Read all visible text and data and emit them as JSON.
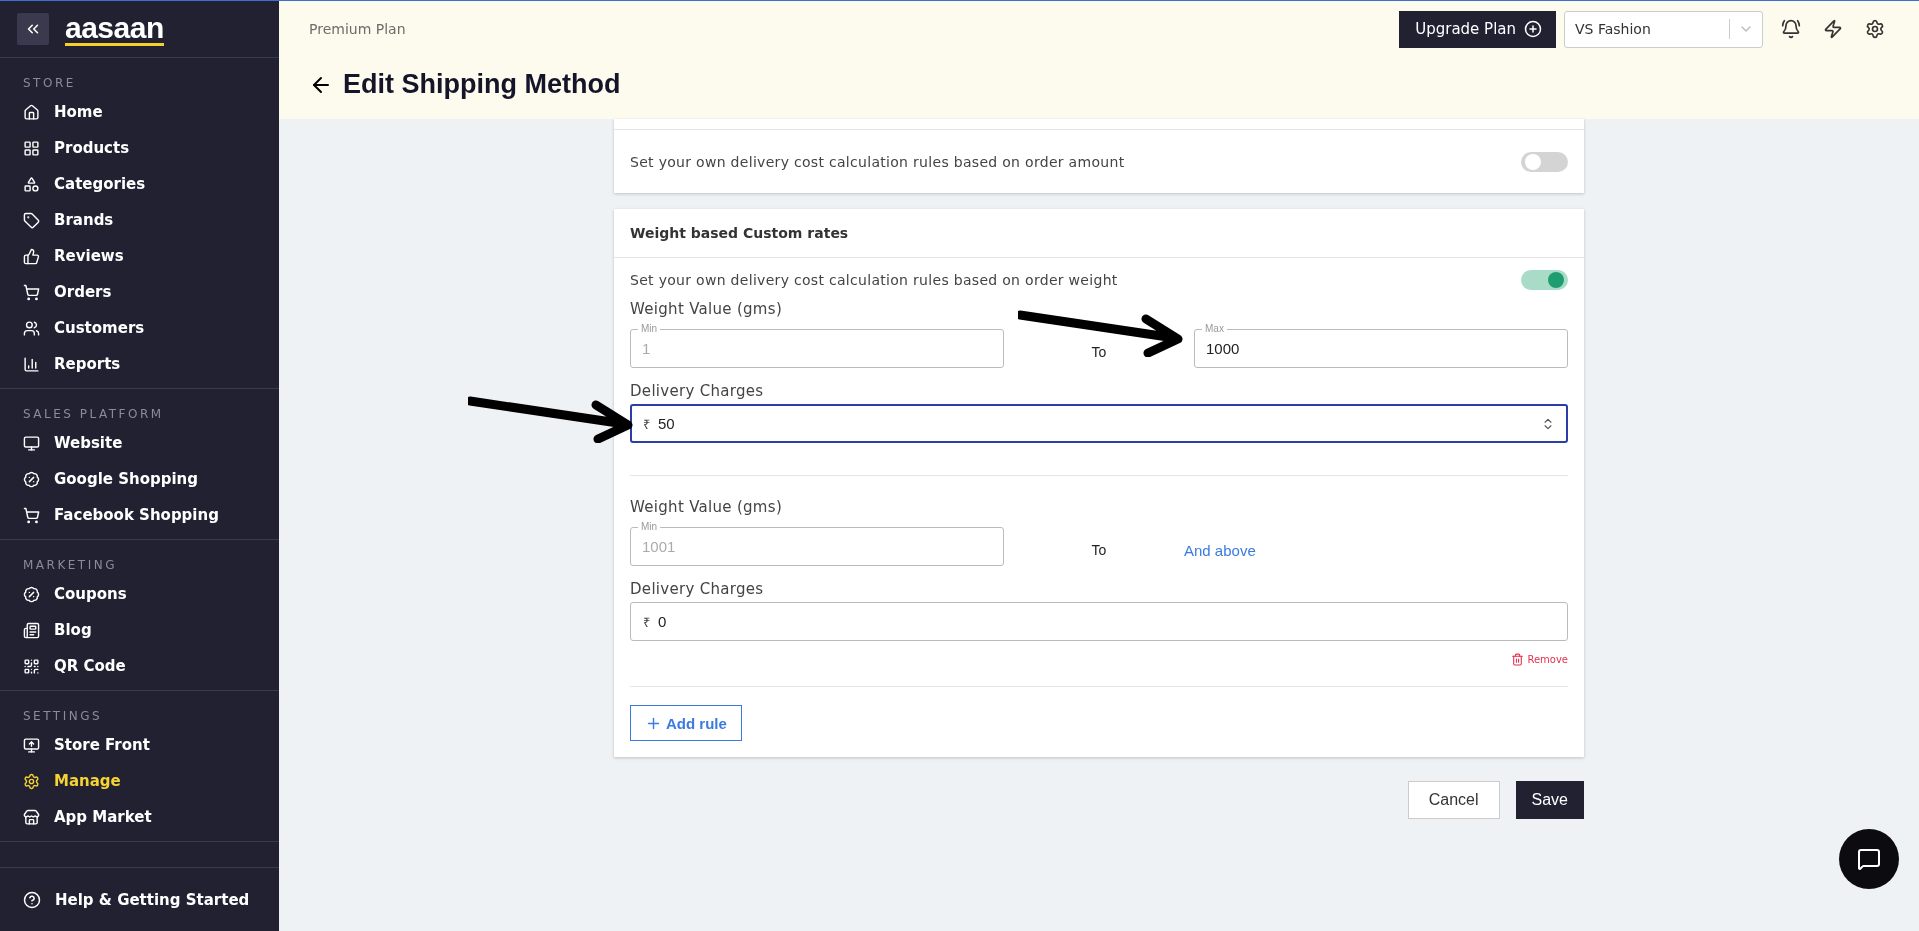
{
  "sidebar": {
    "logo": "aasaan",
    "sections": [
      {
        "title": "STORE",
        "items": [
          {
            "label": "Home",
            "selected": false
          },
          {
            "label": "Products",
            "selected": false
          },
          {
            "label": "Categories",
            "selected": false
          },
          {
            "label": "Brands",
            "selected": false
          },
          {
            "label": "Reviews",
            "selected": false
          },
          {
            "label": "Orders",
            "selected": false
          },
          {
            "label": "Customers",
            "selected": false
          },
          {
            "label": "Reports",
            "selected": false
          }
        ]
      },
      {
        "title": "SALES PLATFORM",
        "items": [
          {
            "label": "Website",
            "selected": false
          },
          {
            "label": "Google Shopping",
            "selected": false
          },
          {
            "label": "Facebook Shopping",
            "selected": false
          }
        ]
      },
      {
        "title": "MARKETING",
        "items": [
          {
            "label": "Coupons",
            "selected": false
          },
          {
            "label": "Blog",
            "selected": false
          },
          {
            "label": "QR Code",
            "selected": false
          }
        ]
      },
      {
        "title": "SETTINGS",
        "items": [
          {
            "label": "Store Front",
            "selected": false
          },
          {
            "label": "Manage",
            "selected": true
          },
          {
            "label": "App Market",
            "selected": false
          }
        ]
      }
    ],
    "footer": "Help & Getting Started"
  },
  "header": {
    "plan": "Premium Plan",
    "upgrade_button": "Upgrade Plan",
    "store_select": "VS Fashion",
    "title": "Edit Shipping Method"
  },
  "amount_card": {
    "description": "Set your own delivery cost calculation rules based on order amount",
    "on": false
  },
  "weight_card": {
    "title": "Weight based Custom rates",
    "description": "Set your own delivery cost calculation rules based on order weight",
    "on": true,
    "rules": [
      {
        "weight_label": "Weight Value (gms)",
        "min": {
          "label": "Min",
          "value": "1",
          "disabled": true
        },
        "to": "To",
        "max": {
          "kind": "field",
          "label": "Max",
          "value": "1000"
        },
        "charges_label": "Delivery Charges",
        "currency": "₹",
        "charges": "50",
        "focused": true
      },
      {
        "weight_label": "Weight Value (gms)",
        "min": {
          "label": "Min",
          "value": "1001",
          "disabled": true
        },
        "to": "To",
        "max": {
          "kind": "text",
          "value": "And above"
        },
        "charges_label": "Delivery Charges",
        "currency": "₹",
        "charges": "0",
        "focused": false,
        "remove": "Remove"
      }
    ],
    "add_rule": "Add rule"
  },
  "actions": {
    "cancel": "Cancel",
    "save": "Save"
  }
}
